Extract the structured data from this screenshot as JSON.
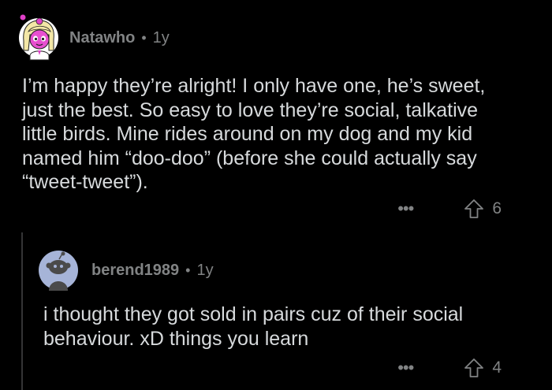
{
  "comment": {
    "author": "Natawho",
    "separator": "•",
    "time": "1y",
    "avatar_icon": "anime-girl-avatar-icon",
    "body": "I’m happy they’re alright! I only have one, he’s sweet,\njust the best. So easy to love they’re social, talkative\nlittle birds. Mine rides around on my dog and my kid\nnamed him “doo-doo” (before she could actually say\n“tweet-tweet”).",
    "more": "•••",
    "upvote_icon": "upvote-arrow-icon",
    "votes": "6"
  },
  "reply": {
    "author": "berend1989",
    "separator": "•",
    "time": "1y",
    "avatar_icon": "default-snoo-avatar-icon",
    "body": "i thought they got sold in pairs cuz of their social\nbehaviour.  xD things you learn",
    "more": "•••",
    "upvote_icon": "upvote-arrow-icon",
    "votes": "4"
  },
  "colors": {
    "background": "#000000",
    "text": "#d7dadc",
    "meta": "#818384",
    "thread_line": "#343536",
    "avatar_pink": "#e040c8",
    "avatar_blue": "#a6b4d8"
  }
}
